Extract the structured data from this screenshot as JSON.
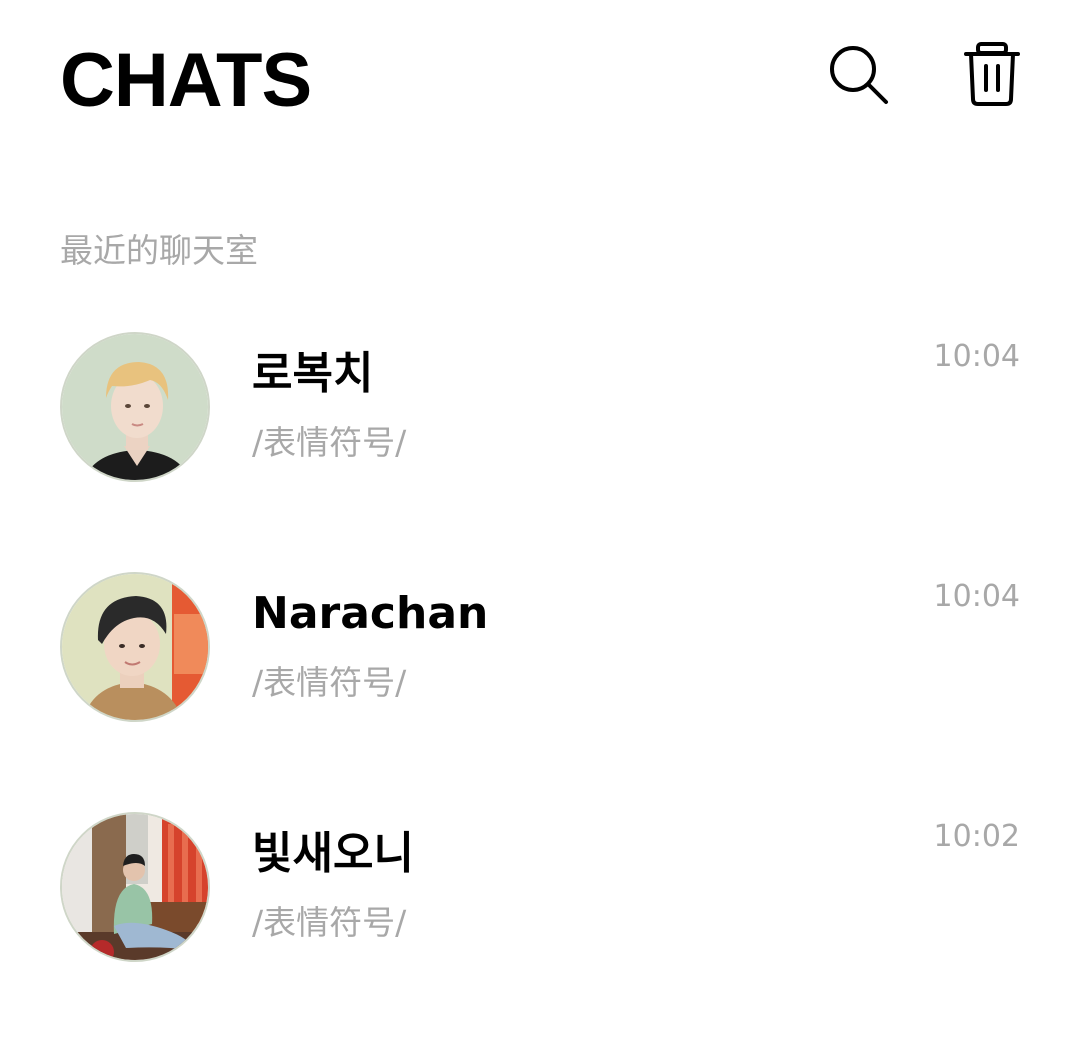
{
  "header": {
    "title": "CHATS",
    "search_icon": "search-icon",
    "trash_icon": "trash-icon"
  },
  "section": {
    "label": "最近的聊天室"
  },
  "chats": [
    {
      "name": "로복치",
      "preview": "/表情符号/",
      "time": "10:04",
      "avatar_icon": "avatar-photo"
    },
    {
      "name": "Narachan",
      "preview": "/表情符号/",
      "time": "10:04",
      "avatar_icon": "avatar-photo"
    },
    {
      "name": "빛새오니",
      "preview": "/表情符号/",
      "time": "10:02",
      "avatar_icon": "avatar-photo"
    }
  ],
  "colors": {
    "background": "#ffffff",
    "primary_text": "#000000",
    "secondary_text": "#a8a8a8"
  }
}
